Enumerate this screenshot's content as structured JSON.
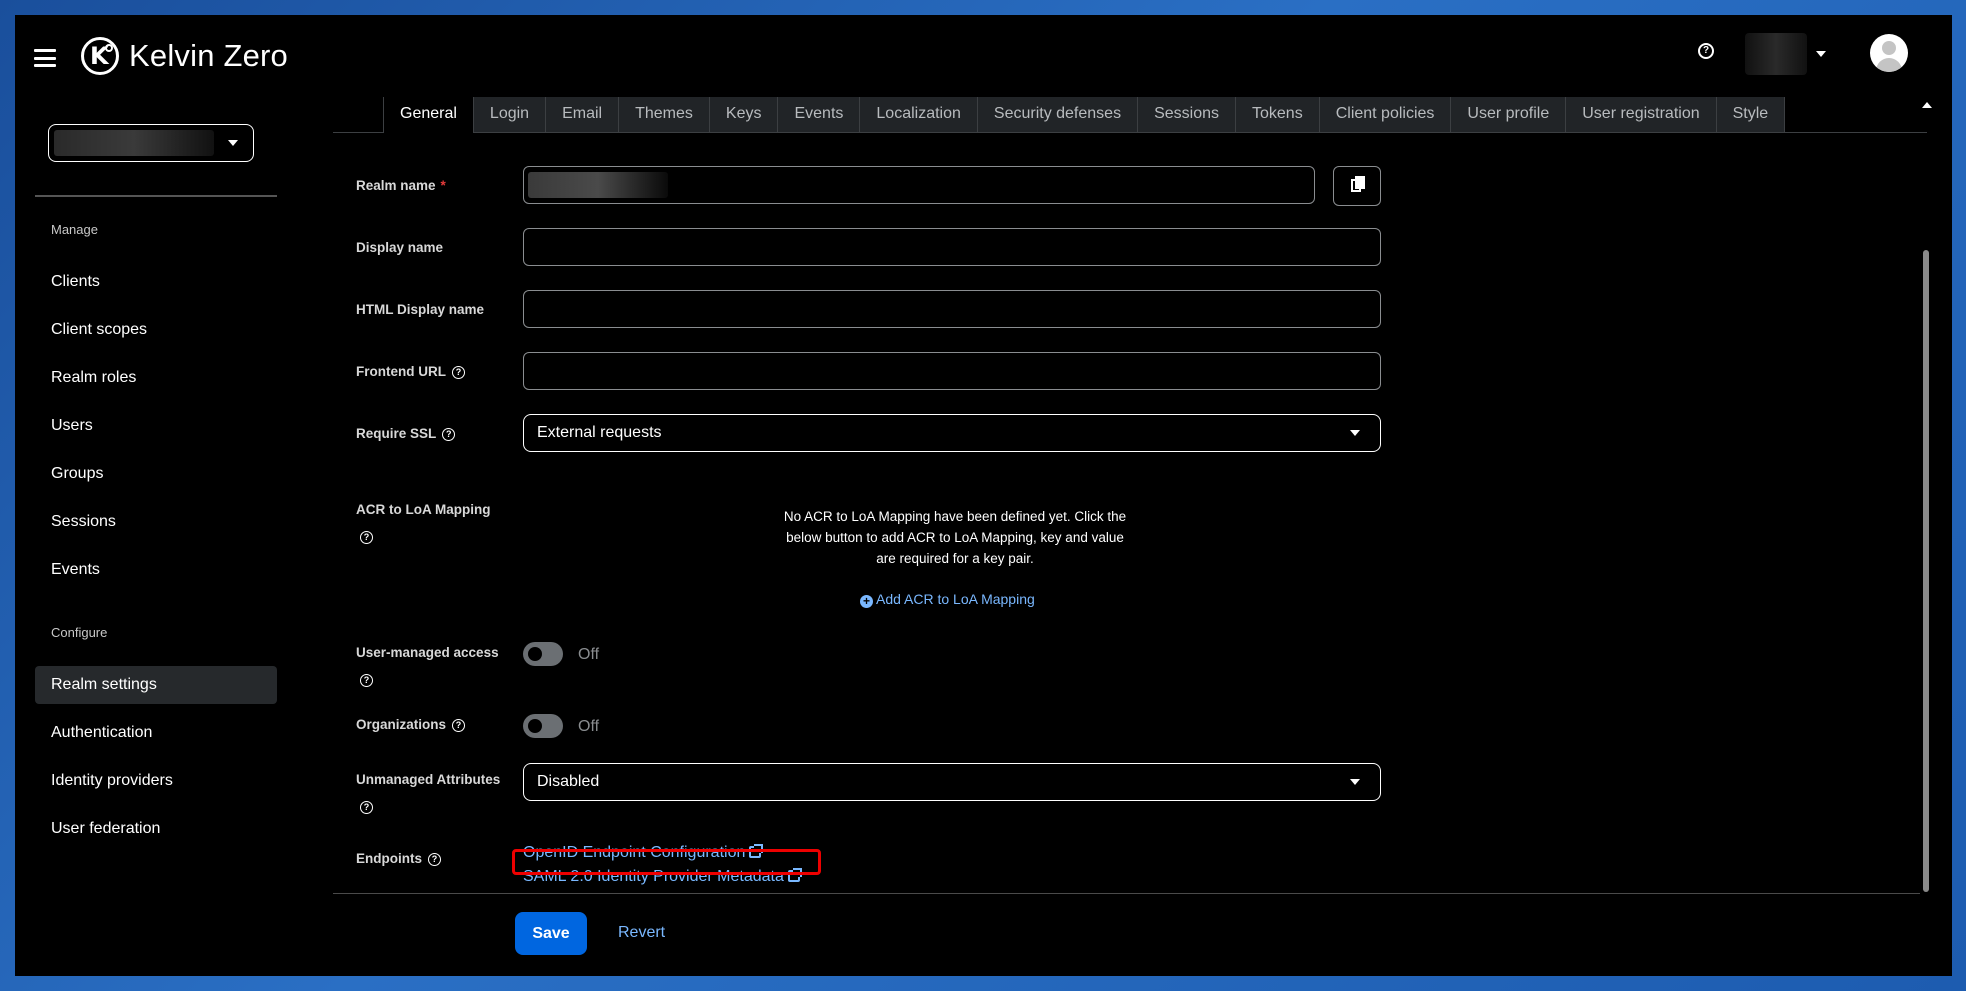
{
  "header": {
    "brand": "Kelvin Zero"
  },
  "sidebar": {
    "manage_label": "Manage",
    "manage_items": [
      "Clients",
      "Client scopes",
      "Realm roles",
      "Users",
      "Groups",
      "Sessions",
      "Events"
    ],
    "configure_label": "Configure",
    "configure_items": [
      "Realm settings",
      "Authentication",
      "Identity providers",
      "User federation"
    ],
    "active_item": "Realm settings"
  },
  "tabs": [
    "General",
    "Login",
    "Email",
    "Themes",
    "Keys",
    "Events",
    "Localization",
    "Security defenses",
    "Sessions",
    "Tokens",
    "Client policies",
    "User profile",
    "User registration",
    "Style"
  ],
  "active_tab": "General",
  "form": {
    "realm_name_label": "Realm name",
    "required_marker": "*",
    "display_name_label": "Display name",
    "html_display_name_label": "HTML Display name",
    "frontend_url_label": "Frontend URL",
    "require_ssl_label": "Require SSL",
    "require_ssl_value": "External requests",
    "acr_label": "ACR to LoA Mapping",
    "acr_empty_text": "No ACR to LoA Mapping have been defined yet. Click the below button to add ACR to LoA Mapping, key and value are required for a key pair.",
    "acr_add_link": "Add ACR to LoA Mapping",
    "user_managed_label": "User-managed access",
    "user_managed_state": "Off",
    "organizations_label": "Organizations",
    "organizations_state": "Off",
    "unmanaged_label": "Unmanaged Attributes",
    "unmanaged_value": "Disabled",
    "endpoints_label": "Endpoints",
    "endpoint_openid": "OpenID Endpoint Configuration",
    "endpoint_saml": "SAML 2.0 Identity Provider Metadata"
  },
  "actions": {
    "save": "Save",
    "revert": "Revert"
  },
  "colors": {
    "accent": "#0066e0",
    "link": "#7ab8ff",
    "highlight": "#ee0000",
    "active_nav": "#26292c"
  }
}
